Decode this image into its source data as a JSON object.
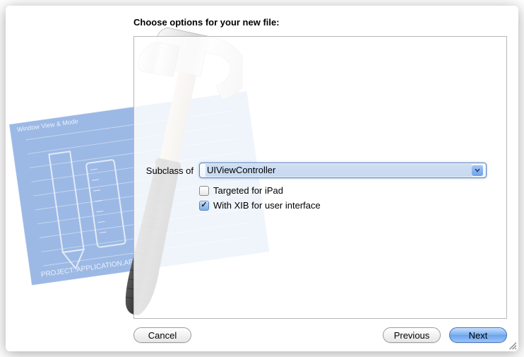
{
  "header": {
    "title": "Choose options for your new file:"
  },
  "form": {
    "subclass_label": "Subclass of",
    "subclass_value": "UIViewController",
    "checkbox_ipad": "Targeted for iPad",
    "checkbox_xib": "With XIB for user interface"
  },
  "buttons": {
    "cancel": "Cancel",
    "previous": "Previous",
    "next": "Next"
  }
}
